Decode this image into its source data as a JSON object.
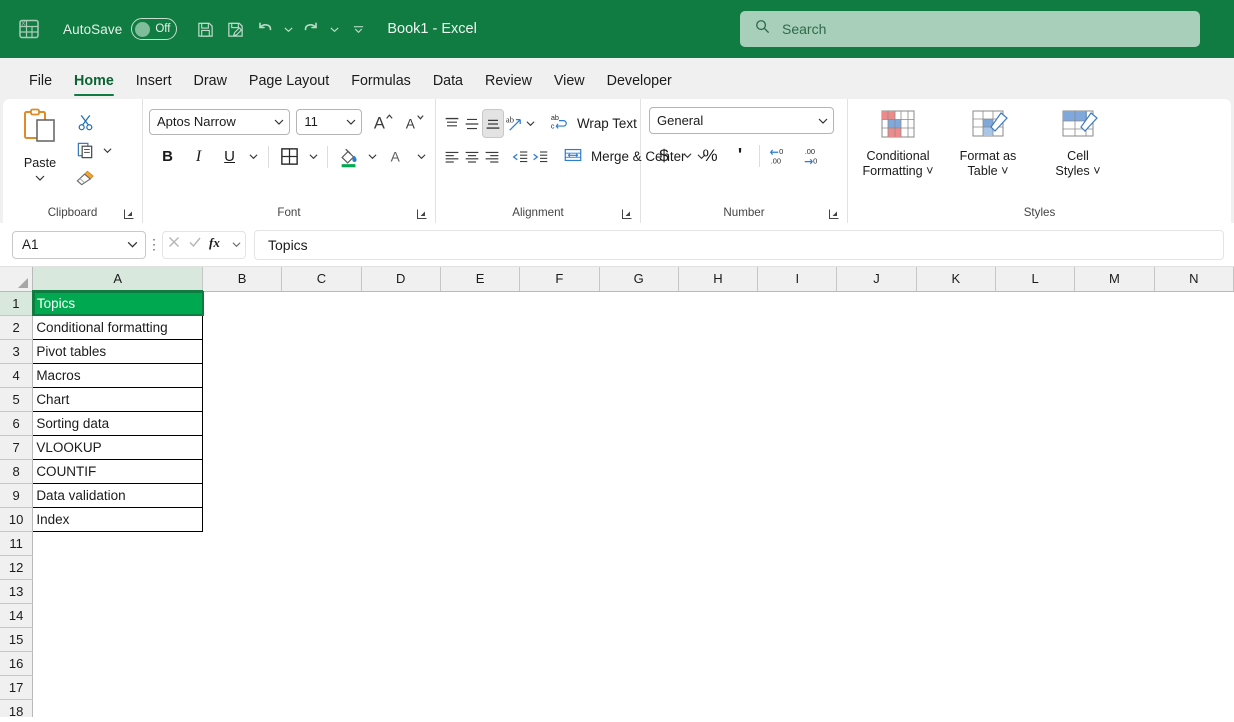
{
  "titlebar": {
    "app_icon": "excel-logo-icon",
    "autosave_label": "AutoSave",
    "autosave_state": "Off",
    "save_icon": "save-icon",
    "save_as_icon": "save-as-icon",
    "undo_icon": "undo-icon",
    "redo_icon": "redo-icon",
    "customize_icon": "customize-quick-access-toolbar-icon",
    "document_title": "Book1  -  Excel",
    "brand_color": "#107c41"
  },
  "search": {
    "placeholder": "Search",
    "icon": "search-icon"
  },
  "ribbon_tabs": [
    {
      "label": "File",
      "active": false
    },
    {
      "label": "Home",
      "active": true
    },
    {
      "label": "Insert",
      "active": false
    },
    {
      "label": "Draw",
      "active": false
    },
    {
      "label": "Page Layout",
      "active": false
    },
    {
      "label": "Formulas",
      "active": false
    },
    {
      "label": "Data",
      "active": false
    },
    {
      "label": "Review",
      "active": false
    },
    {
      "label": "View",
      "active": false
    },
    {
      "label": "Developer",
      "active": false
    }
  ],
  "ribbon": {
    "clipboard": {
      "group_label": "Clipboard",
      "paste_label": "Paste",
      "paste_icon": "paste-icon",
      "cut_icon": "cut-scissors-icon",
      "copy_icon": "copy-icon",
      "format_painter_icon": "format-painter-brush-icon",
      "dialog_launcher_icon": "dialog-launcher-icon"
    },
    "font": {
      "group_label": "Font",
      "font_family_value": "Aptos Narrow",
      "font_size_value": "11",
      "grow_font_icon": "increase-font-size-icon",
      "shrink_font_icon": "decrease-font-size-icon",
      "bold_label": "B",
      "italic_label": "I",
      "underline_label": "U",
      "borders_icon": "borders-icon",
      "fill_color_icon": "fill-color-icon",
      "fill_color_swatch": "#00a94f",
      "font_color_label": "A",
      "font_color_swatch": "#c00000",
      "dialog_launcher_icon": "dialog-launcher-icon"
    },
    "alignment": {
      "group_label": "Alignment",
      "align_top_icon": "align-top-icon",
      "align_middle_icon": "align-middle-icon",
      "align_bottom_icon": "align-bottom-icon",
      "orientation_icon": "text-orientation-icon",
      "align_left_icon": "align-left-icon",
      "align_center_icon": "align-center-icon",
      "align_right_icon": "align-right-icon",
      "decrease_indent_icon": "decrease-indent-icon",
      "increase_indent_icon": "increase-indent-icon",
      "wrap_text_label": "Wrap Text",
      "wrap_text_icon": "wrap-text-icon",
      "merge_center_label": "Merge & Center",
      "merge_center_icon": "merge-and-center-icon",
      "dialog_launcher_icon": "dialog-launcher-icon"
    },
    "number": {
      "group_label": "Number",
      "format_value": "General",
      "currency_label": "$",
      "percent_label": "%",
      "comma_label": "'",
      "increase_decimal_icon": "increase-decimal-icon",
      "decrease_decimal_icon": "decrease-decimal-icon",
      "dialog_launcher_icon": "dialog-launcher-icon"
    },
    "styles": {
      "group_label": "Styles",
      "conditional_formatting_label": "Conditional\nFormatting",
      "conditional_formatting_line1": "Conditional",
      "conditional_formatting_line2": "Formatting",
      "conditional_formatting_icon": "conditional-formatting-icon",
      "format_as_table_line1": "Format as",
      "format_as_table_line2": "Table",
      "format_as_table_icon": "format-as-table-icon",
      "cell_styles_line1": "Cell",
      "cell_styles_line2": "Styles",
      "cell_styles_icon": "cell-styles-icon"
    }
  },
  "formula_bar": {
    "name_box_value": "A1",
    "name_box_caret_icon": "chevron-down-icon",
    "more_options_icon": "vertical-dots-icon",
    "cancel_icon": "cancel-x-icon",
    "enter_icon": "enter-check-icon",
    "function_icon": "insert-function-fx-icon",
    "function_caret_icon": "chevron-down-icon",
    "formula_value": "Topics"
  },
  "grid": {
    "columns": [
      "A",
      "B",
      "C",
      "D",
      "E",
      "F",
      "G",
      "H",
      "I",
      "J",
      "K",
      "L",
      "M",
      "N"
    ],
    "selected_column": "A",
    "selected_row": 1,
    "rows": [
      1,
      2,
      3,
      4,
      5,
      6,
      7,
      8,
      9,
      10,
      11,
      12,
      13,
      14,
      15,
      16,
      17,
      18
    ],
    "active_cell": "A1",
    "header_fill_color": "#00a94f",
    "header_font_color": "#ffffff",
    "column_a_values": [
      "Topics",
      "Conditional formatting",
      "Pivot tables",
      "Macros",
      "Chart",
      "Sorting data",
      "VLOOKUP",
      "COUNTIF",
      "Data validation",
      "Index"
    ]
  }
}
